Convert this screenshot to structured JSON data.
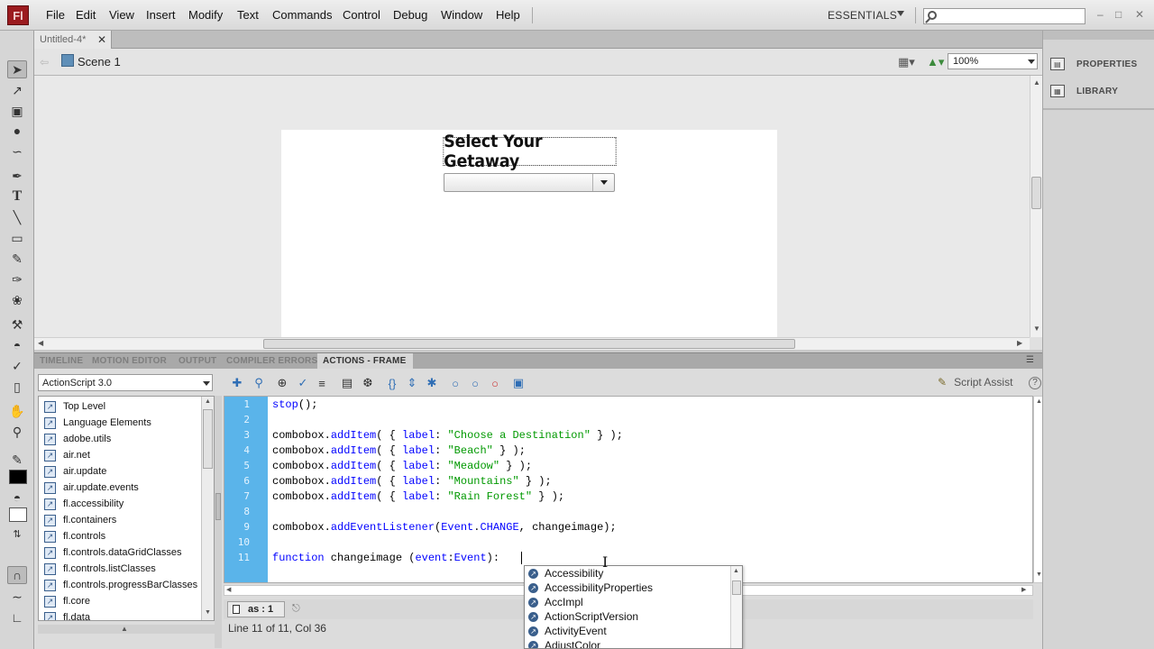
{
  "app": {
    "logo": "Fl"
  },
  "menu": [
    "File",
    "Edit",
    "View",
    "Insert",
    "Modify",
    "Text",
    "Commands",
    "Control",
    "Debug",
    "Window",
    "Help"
  ],
  "workspace": {
    "label": "ESSENTIALS"
  },
  "window_controls": {
    "minimize": "–",
    "maximize": "□",
    "close": "✕"
  },
  "document": {
    "tab_title": "Untitled-4*",
    "close_glyph": "✕"
  },
  "edit_bar": {
    "back_glyph": "⇦",
    "scene": "Scene 1",
    "zoom": "100%"
  },
  "stage": {
    "title_text": "Select Your Getaway",
    "combobox_value": ""
  },
  "panel_tabs": [
    "TIMELINE",
    "MOTION EDITOR",
    "OUTPUT",
    "COMPILER ERRORS",
    "ACTIONS - FRAME"
  ],
  "actions": {
    "version": "ActionScript 3.0",
    "toolbox_items": [
      "Top Level",
      "Language Elements",
      "adobe.utils",
      "air.net",
      "air.update",
      "air.update.events",
      "fl.accessibility",
      "fl.containers",
      "fl.controls",
      "fl.controls.dataGridClasses",
      "fl.controls.listClasses",
      "fl.controls.progressBarClasses",
      "fl.core",
      "fl.data"
    ],
    "script_assist": "Script Assist",
    "help_glyph": "?",
    "line_numbers": [
      "1",
      "2",
      "3",
      "4",
      "5",
      "6",
      "7",
      "8",
      "9",
      "10",
      "11"
    ],
    "script_tab": "as : 1",
    "status": "Line 11 of 11, Col 36"
  },
  "code_hints": [
    "Accessibility",
    "AccessibilityProperties",
    "AccImpl",
    "ActionScriptVersion",
    "ActivityEvent",
    "AdjustColor"
  ],
  "right_panel": {
    "properties": "PROPERTIES",
    "library": "LIBRARY"
  },
  "colors": {
    "gutter": "#5ab4ea",
    "keyword": "#0000ff",
    "string": "#009900",
    "logo_bg": "#9b1b1f"
  },
  "icons": [
    "selection-tool-icon",
    "subselection-tool-icon",
    "free-transform-tool-icon",
    "3d-rotation-tool-icon",
    "lasso-tool-icon",
    "pen-tool-icon",
    "text-tool-icon",
    "line-tool-icon",
    "rectangle-tool-icon",
    "pencil-tool-icon",
    "brush-tool-icon",
    "deco-tool-icon",
    "bone-tool-icon",
    "paint-bucket-icon",
    "eyedropper-icon",
    "eraser-icon",
    "hand-tool-icon",
    "zoom-tool-icon",
    "stroke-color-icon",
    "fill-color-icon",
    "snap-magnet-icon"
  ]
}
